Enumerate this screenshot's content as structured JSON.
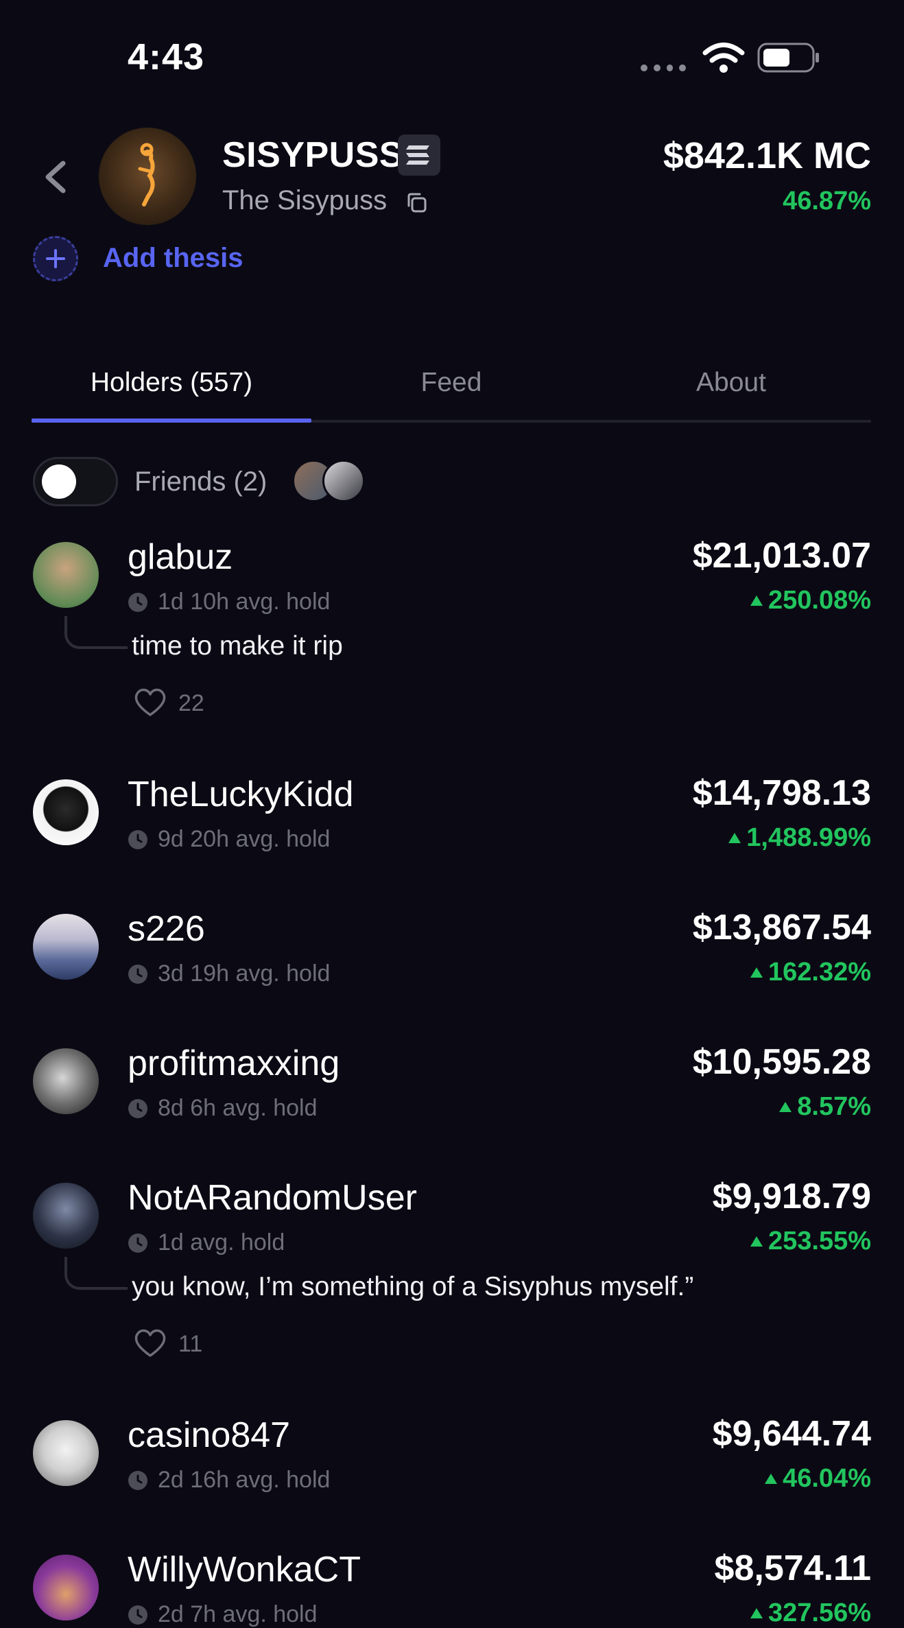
{
  "status": {
    "time": "4:43"
  },
  "token": {
    "ticker": "SISYPUSS",
    "name": "The Sisypuss",
    "market_cap": "$842.1K MC",
    "change": "46.87%",
    "add_thesis": "Add thesis"
  },
  "tabs": [
    {
      "label": "Holders (557)",
      "active": true
    },
    {
      "label": "Feed",
      "active": false
    },
    {
      "label": "About",
      "active": false
    }
  ],
  "friends": {
    "label": "Friends (2)",
    "toggle_on": false
  },
  "holders": [
    {
      "name": "glabuz",
      "hold": "1d 10h avg. hold",
      "value": "$21,013.07",
      "change": "250.08%",
      "comment": "time to make it rip",
      "likes": "22"
    },
    {
      "name": "TheLuckyKidd",
      "hold": "9d 20h avg. hold",
      "value": "$14,798.13",
      "change": "1,488.99%"
    },
    {
      "name": "s226",
      "hold": "3d 19h avg. hold",
      "value": "$13,867.54",
      "change": "162.32%"
    },
    {
      "name": "profitmaxxing",
      "hold": "8d 6h avg. hold",
      "value": "$10,595.28",
      "change": "8.57%"
    },
    {
      "name": "NotARandomUser",
      "hold": "1d avg. hold",
      "value": "$9,918.79",
      "change": "253.55%",
      "comment": "you know, I’m something of a Sisyphus myself.”",
      "likes": "11"
    },
    {
      "name": "casino847",
      "hold": "2d 16h avg. hold",
      "value": "$9,644.74",
      "change": "46.04%"
    },
    {
      "name": "WillyWonkaCT",
      "hold": "2d 7h avg. hold",
      "value": "$8,574.11",
      "change": "327.56%"
    }
  ],
  "colors": {
    "background": "#0b0a14",
    "positive": "#22c55e",
    "accent": "#5865f2"
  }
}
